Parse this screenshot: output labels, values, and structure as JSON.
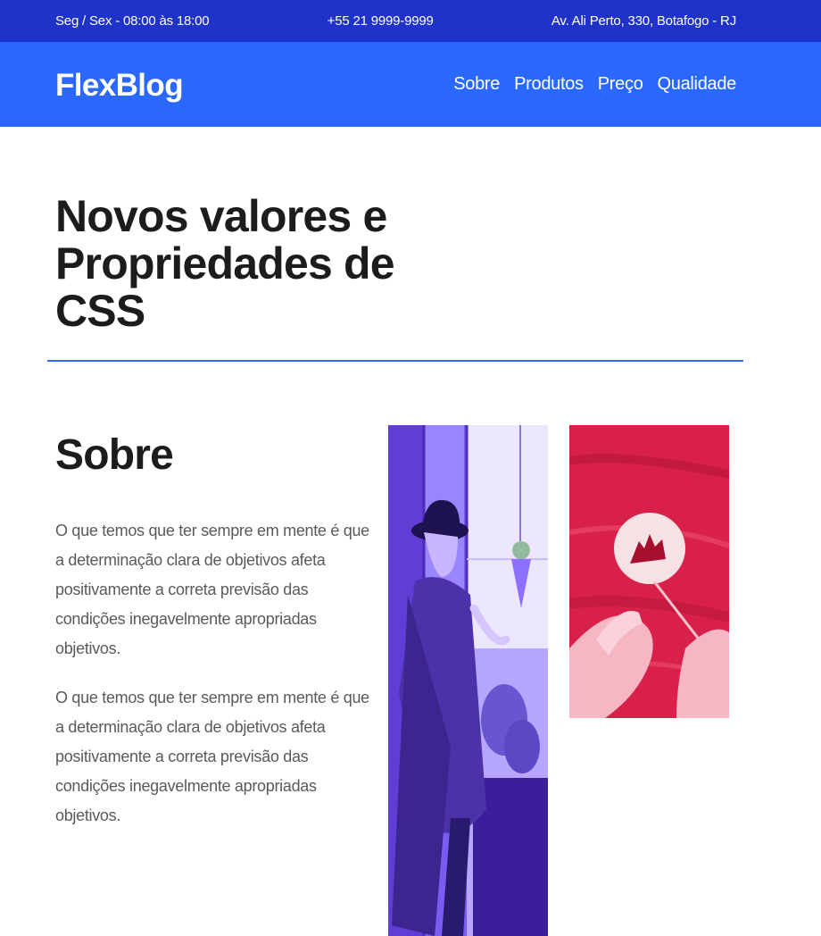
{
  "topbar": {
    "hours": "Seg / Sex - 08:00 às 18:00",
    "phone": "+55 21 9999-9999",
    "address": "Av. Ali Perto, 330, Botafogo - RJ"
  },
  "header": {
    "logo": "FlexBlog",
    "nav": [
      "Sobre",
      "Produtos",
      "Preço",
      "Qualidade"
    ]
  },
  "hero": {
    "title": "Novos valores e Propriedades de CSS"
  },
  "about": {
    "heading": "Sobre",
    "paragraphs": [
      "O que temos que ter sempre em mente é que a determinação clara de objetivos afeta positivamente a correta previsão das condições inegavelmente apropriadas objetivos.",
      "O que temos que ter sempre em mente é que a determinação clara de objetivos afeta positivamente a correta previsão das condições inegavelmente apropriadas objetivos."
    ],
    "images": [
      {
        "name": "woman-with-hat-photo",
        "tint": "#6a3fe0"
      },
      {
        "name": "hands-painting-photo",
        "tint": "#e8214f"
      }
    ]
  },
  "colors": {
    "topbar": "#1f33c8",
    "navbar": "#2b68ff",
    "accent": "#2b68ff"
  }
}
